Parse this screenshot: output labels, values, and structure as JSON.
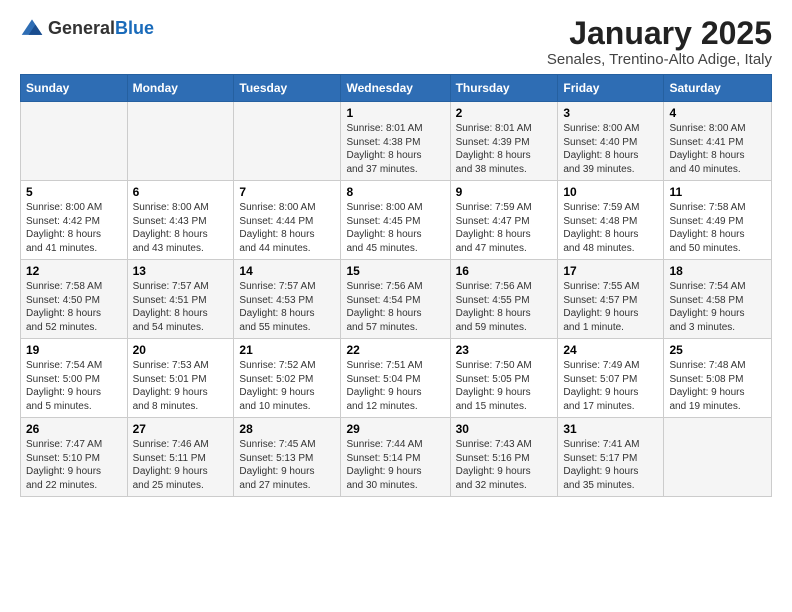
{
  "logo": {
    "general": "General",
    "blue": "Blue"
  },
  "header": {
    "month": "January 2025",
    "location": "Senales, Trentino-Alto Adige, Italy"
  },
  "weekdays": [
    "Sunday",
    "Monday",
    "Tuesday",
    "Wednesday",
    "Thursday",
    "Friday",
    "Saturday"
  ],
  "rows": [
    {
      "cells": [
        {
          "day": "",
          "info": ""
        },
        {
          "day": "",
          "info": ""
        },
        {
          "day": "",
          "info": ""
        },
        {
          "day": "1",
          "info": "Sunrise: 8:01 AM\nSunset: 4:38 PM\nDaylight: 8 hours\nand 37 minutes."
        },
        {
          "day": "2",
          "info": "Sunrise: 8:01 AM\nSunset: 4:39 PM\nDaylight: 8 hours\nand 38 minutes."
        },
        {
          "day": "3",
          "info": "Sunrise: 8:00 AM\nSunset: 4:40 PM\nDaylight: 8 hours\nand 39 minutes."
        },
        {
          "day": "4",
          "info": "Sunrise: 8:00 AM\nSunset: 4:41 PM\nDaylight: 8 hours\nand 40 minutes."
        }
      ]
    },
    {
      "cells": [
        {
          "day": "5",
          "info": "Sunrise: 8:00 AM\nSunset: 4:42 PM\nDaylight: 8 hours\nand 41 minutes."
        },
        {
          "day": "6",
          "info": "Sunrise: 8:00 AM\nSunset: 4:43 PM\nDaylight: 8 hours\nand 43 minutes."
        },
        {
          "day": "7",
          "info": "Sunrise: 8:00 AM\nSunset: 4:44 PM\nDaylight: 8 hours\nand 44 minutes."
        },
        {
          "day": "8",
          "info": "Sunrise: 8:00 AM\nSunset: 4:45 PM\nDaylight: 8 hours\nand 45 minutes."
        },
        {
          "day": "9",
          "info": "Sunrise: 7:59 AM\nSunset: 4:47 PM\nDaylight: 8 hours\nand 47 minutes."
        },
        {
          "day": "10",
          "info": "Sunrise: 7:59 AM\nSunset: 4:48 PM\nDaylight: 8 hours\nand 48 minutes."
        },
        {
          "day": "11",
          "info": "Sunrise: 7:58 AM\nSunset: 4:49 PM\nDaylight: 8 hours\nand 50 minutes."
        }
      ]
    },
    {
      "cells": [
        {
          "day": "12",
          "info": "Sunrise: 7:58 AM\nSunset: 4:50 PM\nDaylight: 8 hours\nand 52 minutes."
        },
        {
          "day": "13",
          "info": "Sunrise: 7:57 AM\nSunset: 4:51 PM\nDaylight: 8 hours\nand 54 minutes."
        },
        {
          "day": "14",
          "info": "Sunrise: 7:57 AM\nSunset: 4:53 PM\nDaylight: 8 hours\nand 55 minutes."
        },
        {
          "day": "15",
          "info": "Sunrise: 7:56 AM\nSunset: 4:54 PM\nDaylight: 8 hours\nand 57 minutes."
        },
        {
          "day": "16",
          "info": "Sunrise: 7:56 AM\nSunset: 4:55 PM\nDaylight: 8 hours\nand 59 minutes."
        },
        {
          "day": "17",
          "info": "Sunrise: 7:55 AM\nSunset: 4:57 PM\nDaylight: 9 hours\nand 1 minute."
        },
        {
          "day": "18",
          "info": "Sunrise: 7:54 AM\nSunset: 4:58 PM\nDaylight: 9 hours\nand 3 minutes."
        }
      ]
    },
    {
      "cells": [
        {
          "day": "19",
          "info": "Sunrise: 7:54 AM\nSunset: 5:00 PM\nDaylight: 9 hours\nand 5 minutes."
        },
        {
          "day": "20",
          "info": "Sunrise: 7:53 AM\nSunset: 5:01 PM\nDaylight: 9 hours\nand 8 minutes."
        },
        {
          "day": "21",
          "info": "Sunrise: 7:52 AM\nSunset: 5:02 PM\nDaylight: 9 hours\nand 10 minutes."
        },
        {
          "day": "22",
          "info": "Sunrise: 7:51 AM\nSunset: 5:04 PM\nDaylight: 9 hours\nand 12 minutes."
        },
        {
          "day": "23",
          "info": "Sunrise: 7:50 AM\nSunset: 5:05 PM\nDaylight: 9 hours\nand 15 minutes."
        },
        {
          "day": "24",
          "info": "Sunrise: 7:49 AM\nSunset: 5:07 PM\nDaylight: 9 hours\nand 17 minutes."
        },
        {
          "day": "25",
          "info": "Sunrise: 7:48 AM\nSunset: 5:08 PM\nDaylight: 9 hours\nand 19 minutes."
        }
      ]
    },
    {
      "cells": [
        {
          "day": "26",
          "info": "Sunrise: 7:47 AM\nSunset: 5:10 PM\nDaylight: 9 hours\nand 22 minutes."
        },
        {
          "day": "27",
          "info": "Sunrise: 7:46 AM\nSunset: 5:11 PM\nDaylight: 9 hours\nand 25 minutes."
        },
        {
          "day": "28",
          "info": "Sunrise: 7:45 AM\nSunset: 5:13 PM\nDaylight: 9 hours\nand 27 minutes."
        },
        {
          "day": "29",
          "info": "Sunrise: 7:44 AM\nSunset: 5:14 PM\nDaylight: 9 hours\nand 30 minutes."
        },
        {
          "day": "30",
          "info": "Sunrise: 7:43 AM\nSunset: 5:16 PM\nDaylight: 9 hours\nand 32 minutes."
        },
        {
          "day": "31",
          "info": "Sunrise: 7:41 AM\nSunset: 5:17 PM\nDaylight: 9 hours\nand 35 minutes."
        },
        {
          "day": "",
          "info": ""
        }
      ]
    }
  ]
}
